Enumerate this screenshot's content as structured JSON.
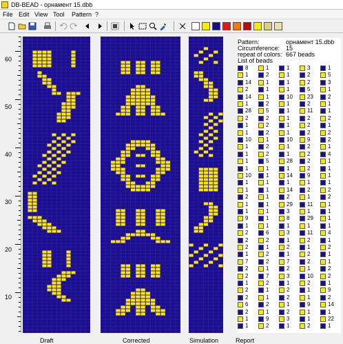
{
  "window": {
    "title": "DB-BEAD - орнамент 15.dbb"
  },
  "menu": [
    "File",
    "Edit",
    "View",
    "Tool",
    "Pattern",
    "?"
  ],
  "toolbar": {
    "icons": [
      "new-file-icon",
      "open-folder-icon",
      "save-icon",
      "print-icon",
      "undo-icon",
      "redo-icon",
      "arrow-left-icon",
      "arrow-right-icon",
      "fill-icon",
      "pointer-icon",
      "select-rect-icon",
      "zoom-icon",
      "eyedropper-icon"
    ],
    "colors": [
      "#ffffff",
      "#ffe900",
      "#1b0f8f",
      "#d81c18",
      "#ee7a10",
      "#b01010",
      "#ffe900",
      "#d8d080",
      "#e8e0a8"
    ]
  },
  "colors": {
    "bead_primary": "#1b0f8f",
    "bead_secondary": "#ffe900"
  },
  "ruler": {
    "labels": [
      "60",
      "50",
      "40",
      "30",
      "20",
      "10"
    ]
  },
  "panels": {
    "draft": "Draft",
    "corrected": "Corrected",
    "simulation": "Simulation",
    "report": "Report"
  },
  "report": {
    "pattern_label": "Pattern:",
    "pattern_value": "орнамент 15.dbb",
    "circ_label": "Circumference:",
    "circ_value": "15",
    "repeat_label": "repeat of colors:",
    "repeat_value": "667 beads",
    "list_label": "List of beads",
    "rows": [
      [
        [
          "b",
          "8"
        ],
        [
          "y",
          "1"
        ],
        [
          "b",
          "1"
        ],
        [
          "y",
          "3"
        ],
        [
          "b",
          "1"
        ]
      ],
      [
        [
          "y",
          "1"
        ],
        [
          "b",
          "2"
        ],
        [
          "y",
          "1"
        ],
        [
          "b",
          "2"
        ],
        [
          "y",
          "5"
        ]
      ],
      [
        [
          "b",
          "14"
        ],
        [
          "y",
          "1"
        ],
        [
          "b",
          "1"
        ],
        [
          "y",
          "2"
        ],
        [
          "b",
          "3"
        ]
      ],
      [
        [
          "y",
          "2"
        ],
        [
          "b",
          "1"
        ],
        [
          "y",
          "1"
        ],
        [
          "b",
          "5"
        ],
        [
          "y",
          "1"
        ]
      ],
      [
        [
          "b",
          "14"
        ],
        [
          "y",
          "1"
        ],
        [
          "b",
          "10"
        ],
        [
          "y",
          "23"
        ],
        [
          "b",
          "2"
        ]
      ],
      [
        [
          "y",
          "1"
        ],
        [
          "b",
          "2"
        ],
        [
          "y",
          "1"
        ],
        [
          "b",
          "2"
        ],
        [
          "y",
          "1"
        ]
      ],
      [
        [
          "b",
          "28"
        ],
        [
          "y",
          "5"
        ],
        [
          "b",
          "1"
        ],
        [
          "y",
          "11"
        ],
        [
          "b",
          "1"
        ]
      ],
      [
        [
          "y",
          "2"
        ],
        [
          "b",
          "2"
        ],
        [
          "y",
          "1"
        ],
        [
          "b",
          "2"
        ],
        [
          "y",
          "2"
        ]
      ],
      [
        [
          "b",
          "1"
        ],
        [
          "y",
          "2"
        ],
        [
          "b",
          "1"
        ],
        [
          "y",
          "2"
        ],
        [
          "b",
          "1"
        ]
      ],
      [
        [
          "y",
          "1"
        ],
        [
          "b",
          "2"
        ],
        [
          "y",
          "1"
        ],
        [
          "b",
          "2"
        ],
        [
          "y",
          "2"
        ]
      ],
      [
        [
          "b",
          "10"
        ],
        [
          "y",
          "1"
        ],
        [
          "b",
          "10"
        ],
        [
          "y",
          "9"
        ],
        [
          "b",
          "2"
        ]
      ],
      [
        [
          "y",
          "1"
        ],
        [
          "b",
          "2"
        ],
        [
          "y",
          "1"
        ],
        [
          "b",
          "2"
        ],
        [
          "y",
          "1"
        ]
      ],
      [
        [
          "b",
          "1"
        ],
        [
          "y",
          "2"
        ],
        [
          "b",
          "1"
        ],
        [
          "y",
          "2"
        ],
        [
          "b",
          "4"
        ]
      ],
      [
        [
          "y",
          "1"
        ],
        [
          "b",
          "5"
        ],
        [
          "y",
          "28"
        ],
        [
          "b",
          "2"
        ],
        [
          "y",
          "1"
        ]
      ],
      [
        [
          "b",
          "1"
        ],
        [
          "y",
          "1"
        ],
        [
          "b",
          "1"
        ],
        [
          "y",
          "2"
        ],
        [
          "b",
          "1"
        ]
      ],
      [
        [
          "y",
          "10"
        ],
        [
          "b",
          "1"
        ],
        [
          "y",
          "14"
        ],
        [
          "b",
          "9"
        ],
        [
          "y",
          "1"
        ]
      ],
      [
        [
          "b",
          "1"
        ],
        [
          "y",
          "1"
        ],
        [
          "b",
          "1"
        ],
        [
          "y",
          "1"
        ],
        [
          "b",
          "1"
        ]
      ],
      [
        [
          "y",
          "1"
        ],
        [
          "b",
          "1"
        ],
        [
          "y",
          "14"
        ],
        [
          "b",
          "2"
        ],
        [
          "y",
          "2"
        ]
      ],
      [
        [
          "b",
          "2"
        ],
        [
          "y",
          "1"
        ],
        [
          "b",
          "2"
        ],
        [
          "y",
          "1"
        ],
        [
          "b",
          "2"
        ]
      ],
      [
        [
          "y",
          "1"
        ],
        [
          "b",
          "1"
        ],
        [
          "y",
          "29"
        ],
        [
          "b",
          "11"
        ],
        [
          "y",
          "1"
        ]
      ],
      [
        [
          "b",
          "1"
        ],
        [
          "y",
          "1"
        ],
        [
          "b",
          "3"
        ],
        [
          "y",
          "1"
        ],
        [
          "b",
          "1"
        ]
      ],
      [
        [
          "y",
          "9"
        ],
        [
          "b",
          "1"
        ],
        [
          "y",
          "8"
        ],
        [
          "b",
          "29"
        ],
        [
          "y",
          "1"
        ]
      ],
      [
        [
          "b",
          "1"
        ],
        [
          "y",
          "1"
        ],
        [
          "b",
          "1"
        ],
        [
          "y",
          "1"
        ],
        [
          "b",
          "1"
        ]
      ],
      [
        [
          "y",
          "2"
        ],
        [
          "b",
          "6"
        ],
        [
          "y",
          "3"
        ],
        [
          "b",
          "11"
        ],
        [
          "y",
          "4"
        ]
      ],
      [
        [
          "b",
          "2"
        ],
        [
          "y",
          "2"
        ],
        [
          "b",
          "1"
        ],
        [
          "y",
          "2"
        ],
        [
          "b",
          "1"
        ]
      ],
      [
        [
          "y",
          "2"
        ],
        [
          "b",
          "1"
        ],
        [
          "y",
          "2"
        ],
        [
          "b",
          "1"
        ],
        [
          "y",
          "2"
        ]
      ],
      [
        [
          "b",
          "1"
        ],
        [
          "y",
          "2"
        ],
        [
          "b",
          "1"
        ],
        [
          "y",
          "2"
        ],
        [
          "b",
          "1"
        ]
      ],
      [
        [
          "y",
          "7"
        ],
        [
          "b",
          "2"
        ],
        [
          "y",
          "7"
        ],
        [
          "b",
          "2"
        ],
        [
          "y",
          "1"
        ]
      ],
      [
        [
          "b",
          "2"
        ],
        [
          "y",
          "1"
        ],
        [
          "b",
          "2"
        ],
        [
          "y",
          "1"
        ],
        [
          "b",
          "2"
        ]
      ],
      [
        [
          "y",
          "2"
        ],
        [
          "b",
          "7"
        ],
        [
          "y",
          "3"
        ],
        [
          "b",
          "10"
        ],
        [
          "y",
          "2"
        ]
      ],
      [
        [
          "b",
          "1"
        ],
        [
          "y",
          "2"
        ],
        [
          "b",
          "1"
        ],
        [
          "y",
          "2"
        ],
        [
          "b",
          "1"
        ]
      ],
      [
        [
          "y",
          "2"
        ],
        [
          "b",
          "1"
        ],
        [
          "y",
          "2"
        ],
        [
          "b",
          "1"
        ],
        [
          "y",
          "9"
        ]
      ],
      [
        [
          "b",
          "2"
        ],
        [
          "y",
          "1"
        ],
        [
          "b",
          "2"
        ],
        [
          "y",
          "1"
        ],
        [
          "b",
          "2"
        ]
      ],
      [
        [
          "y",
          "6"
        ],
        [
          "b",
          "2"
        ],
        [
          "y",
          "1"
        ],
        [
          "b",
          "9"
        ],
        [
          "y",
          "14"
        ]
      ],
      [
        [
          "b",
          "2"
        ],
        [
          "y",
          "1"
        ],
        [
          "b",
          "2"
        ],
        [
          "y",
          "1"
        ],
        [
          "b",
          "1"
        ]
      ],
      [
        [
          "y",
          "1"
        ],
        [
          "b",
          "9"
        ],
        [
          "y",
          "3"
        ],
        [
          "b",
          "1"
        ],
        [
          "y",
          "22"
        ]
      ],
      [
        [
          "b",
          "1"
        ],
        [
          "y",
          "2"
        ],
        [
          "b",
          "1"
        ],
        [
          "y",
          "2"
        ],
        [
          "b",
          "1"
        ]
      ]
    ]
  }
}
